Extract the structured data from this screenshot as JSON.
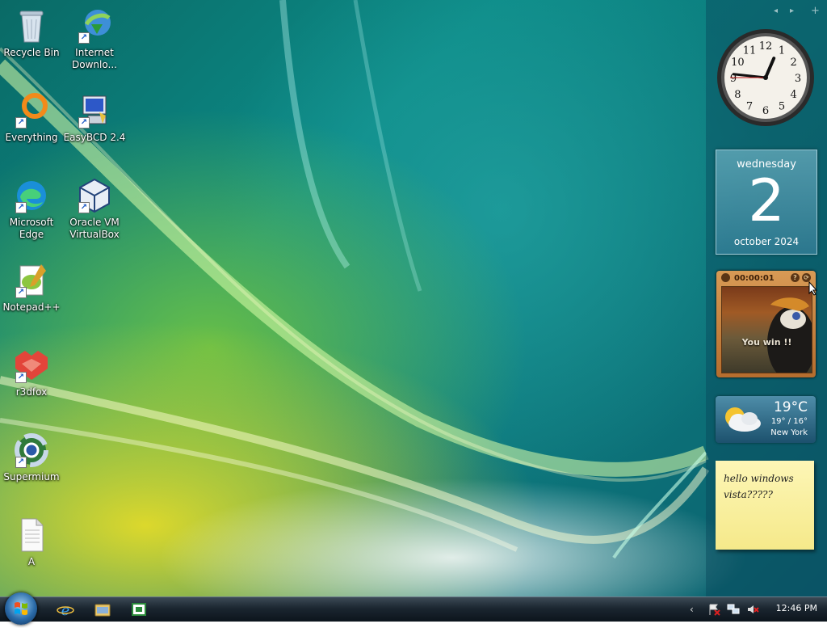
{
  "desktop": {
    "icons": [
      {
        "label": "Recycle Bin",
        "icon": "recycle-bin-icon"
      },
      {
        "label": "Internet Downlo...",
        "icon": "internet-download-manager-icon"
      },
      {
        "label": "Everything",
        "icon": "everything-search-icon"
      },
      {
        "label": "EasyBCD 2.4",
        "icon": "easybcd-icon"
      },
      {
        "label": "Microsoft Edge",
        "icon": "edge-icon"
      },
      {
        "label": "Oracle VM VirtualBox",
        "icon": "virtualbox-icon"
      },
      {
        "label": "Notepad++",
        "icon": "notepad-plus-plus-icon"
      },
      {
        "label": "r3dfox",
        "icon": "r3dfox-icon"
      },
      {
        "label": "Supermium",
        "icon": "supermium-icon"
      },
      {
        "label": "A",
        "icon": "text-document-icon"
      }
    ]
  },
  "sidebar": {
    "clock": {
      "hour": 12,
      "minute": 46,
      "second": 45
    },
    "calendar": {
      "weekday": "wednesday",
      "day": "2",
      "month_year": "october 2024"
    },
    "puzzle": {
      "timer": "00:00:01",
      "message": "You win !!"
    },
    "weather": {
      "temp": "19°C",
      "range": "19° / 16°",
      "city": "New York"
    },
    "notes": {
      "text": "hello windows vista?????"
    }
  },
  "taskbar": {
    "pinned": [
      "internet-explorer-icon",
      "explorer-folder-icon",
      "app-window-icon"
    ],
    "time": "12:46 PM"
  },
  "colors": {
    "note_bg": "#fdf6b6",
    "taskbar": "#1b2630"
  }
}
